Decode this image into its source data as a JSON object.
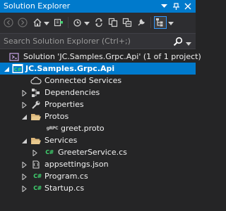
{
  "window": {
    "title": "Solution Explorer"
  },
  "search": {
    "placeholder": "Search Solution Explorer (Ctrl+;)"
  },
  "tree": {
    "solution": "Solution 'JC.Samples.Grpc.Api' (1 of 1 project)",
    "project": "JC.Samples.Grpc.Api",
    "connected_services": "Connected Services",
    "dependencies": "Dependencies",
    "properties": "Properties",
    "protos": "Protos",
    "greet_proto": "greet.proto",
    "services": "Services",
    "greeter_service": "GreeterService.cs",
    "appsettings": "appsettings.json",
    "program": "Program.cs",
    "startup": "Startup.cs"
  },
  "icons": {
    "csharp_badge": "C#",
    "proto_badge": "gRPC"
  },
  "colors": {
    "accent": "#007acc",
    "background": "#252526",
    "toolbar": "#2d2d30",
    "csharp": "#3fd26f",
    "folder": "#dcb67a"
  }
}
